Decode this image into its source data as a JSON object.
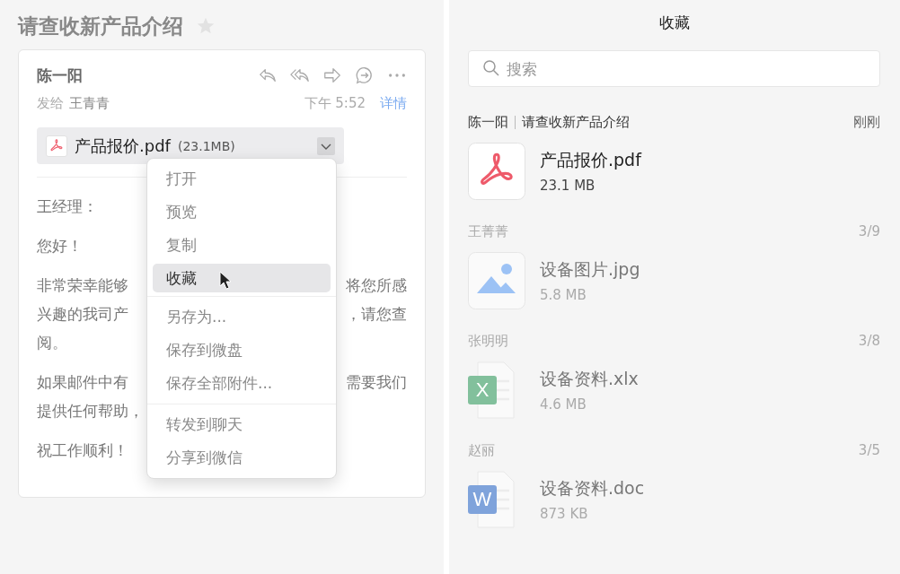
{
  "mail": {
    "subject": "请查收新产品介绍",
    "starred": false,
    "sender": "陈一阳",
    "to_label": "发给",
    "to": "王青青",
    "time": "下午 5:52",
    "details_link": "详情",
    "attachment": {
      "name": "产品报价.pdf",
      "size": "(23.1MB)",
      "menu_open": true
    },
    "body": [
      {
        "lines": [
          {
            "left": "王经理："
          }
        ]
      },
      {
        "lines": [
          {
            "left": "您好！"
          }
        ]
      },
      {
        "lines": [
          {
            "left": "非常荣幸能够",
            "right": "将您所感"
          },
          {
            "left": "兴趣的我司产",
            "right": "，请您查"
          },
          {
            "left": "阅。"
          }
        ]
      },
      {
        "lines": [
          {
            "left": "如果邮件中有",
            "right": "需要我们"
          },
          {
            "left": "提供任何帮助，"
          }
        ]
      },
      {
        "lines": [
          {
            "left": "祝工作顺利！"
          }
        ]
      }
    ]
  },
  "attachment_menu": [
    [
      {
        "label": "打开",
        "selected": false
      },
      {
        "label": "预览",
        "selected": false
      },
      {
        "label": "复制",
        "selected": false
      },
      {
        "label": "收藏",
        "selected": true
      }
    ],
    [
      {
        "label": "另存为...",
        "selected": false
      },
      {
        "label": "保存到微盘",
        "selected": false
      },
      {
        "label": "保存全部附件...",
        "selected": false
      }
    ],
    [
      {
        "label": "转发到聊天",
        "selected": false
      },
      {
        "label": "分享到微信",
        "selected": false
      }
    ]
  ],
  "favorites": {
    "title": "收藏",
    "search": {
      "placeholder": "搜索"
    },
    "groups": [
      {
        "sender": "陈一阳",
        "subject": "请查收新产品介绍",
        "meta": "刚刚",
        "highlighted": true,
        "file": {
          "kind": "pdf",
          "name": "产品报价.pdf",
          "size": "23.1 MB"
        }
      },
      {
        "sender": "王菁菁",
        "meta": "3/9",
        "highlighted": false,
        "file": {
          "kind": "image",
          "name": "设备图片.jpg",
          "size": "5.8 MB"
        }
      },
      {
        "sender": "张明明",
        "meta": "3/8",
        "highlighted": false,
        "file": {
          "kind": "xls",
          "badge": "X",
          "name": "设备资料.xlx",
          "size": "4.6 MB"
        }
      },
      {
        "sender": "赵丽",
        "meta": "3/5",
        "highlighted": false,
        "file": {
          "kind": "doc",
          "badge": "W",
          "name": "设备资料.doc",
          "size": "873 KB"
        }
      }
    ]
  }
}
